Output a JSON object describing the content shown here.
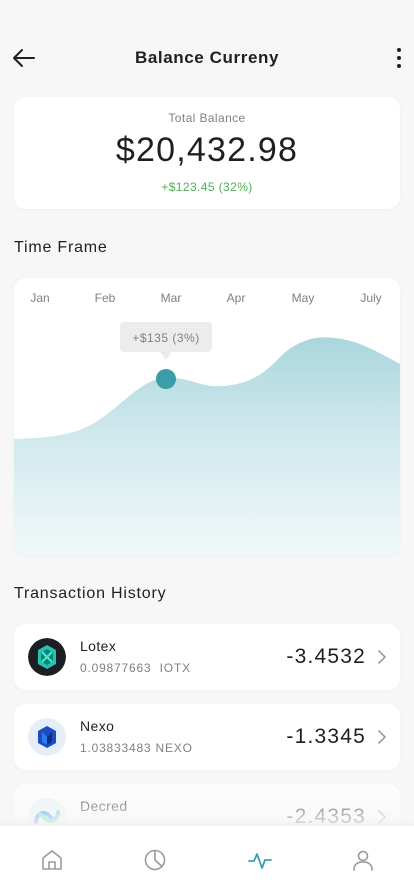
{
  "header": {
    "title": "Balance Curreny"
  },
  "balance": {
    "label": "Total Balance",
    "amount": "$20,432.98",
    "change": "+$123.45 (32%)"
  },
  "time_frame": {
    "title": "Time Frame",
    "months": [
      "Jan",
      "Feb",
      "Mar",
      "Apr",
      "May",
      "July"
    ],
    "tooltip": "+$135 (3%)"
  },
  "history": {
    "title": "Transaction History",
    "items": [
      {
        "name": "Lotex",
        "sub": "0.09877663  IOTX",
        "amount": "-3.4532",
        "icon": "iotex-icon"
      },
      {
        "name": "Nexo",
        "sub": "1.03833483 NEXO",
        "amount": "-1.3345",
        "icon": "nexo-icon"
      },
      {
        "name": "Decred",
        "sub": "",
        "amount": "-2.4353",
        "icon": "decred-icon"
      }
    ]
  },
  "tabbar": {
    "active": "activity",
    "tabs": [
      "home-icon",
      "pie-chart-icon",
      "activity-icon",
      "user-icon"
    ]
  },
  "colors": {
    "accent": "#3a9eaa",
    "positive": "#4caf50",
    "chart_fill": "#b8dde3"
  }
}
